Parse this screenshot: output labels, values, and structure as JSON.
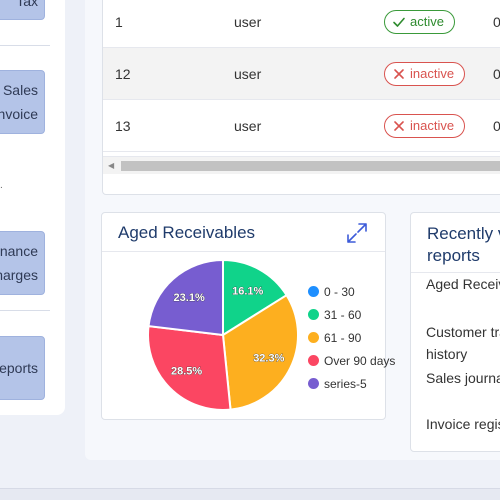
{
  "sidebar": {
    "buttons": [
      {
        "lines": [
          "Tax"
        ]
      },
      {
        "lines": [
          "Sales",
          "Invoice"
        ]
      },
      {
        "lines": [
          "Finance",
          "Charges"
        ]
      },
      {
        "lines": [
          "Reports"
        ]
      }
    ],
    "mark": "."
  },
  "table": {
    "rows": [
      {
        "id": "1",
        "role": "user",
        "status": "active",
        "last": "0"
      },
      {
        "id": "12",
        "role": "user",
        "status": "inactive",
        "last": "0"
      },
      {
        "id": "13",
        "role": "user",
        "status": "inactive",
        "last": "0"
      }
    ]
  },
  "aged_receivables": {
    "title": "Aged Receivables",
    "chart_data": {
      "type": "pie",
      "title": "Aged Receivables",
      "categories": [
        "0 - 30",
        "31 - 60",
        "61 - 90",
        "Over 90 days",
        "series-5"
      ],
      "values": [
        0,
        16.1,
        32.3,
        28.5,
        23.1
      ],
      "labels": [
        "",
        "16.1%",
        "32.3%",
        "28.5%",
        "23.1%"
      ],
      "colors": [
        "#1e8fff",
        "#10d38a",
        "#fdaf1f",
        "#fb4662",
        "#775dd0"
      ],
      "legend": "right"
    }
  },
  "recent_reports": {
    "title_lines": [
      "Recently viewed",
      "reports"
    ],
    "items": [
      {
        "lines": [
          "Aged Receivables"
        ]
      },
      {
        "lines": [
          "Customer transaction",
          "history"
        ]
      },
      {
        "lines": [
          "Sales journal"
        ]
      },
      {
        "lines": [
          "Invoice register"
        ]
      }
    ]
  },
  "colors": {
    "accent": "#1f3b6b",
    "active": "#2e8b2e",
    "inactive": "#d9534f",
    "sidebar_button": "#b4c4e8"
  }
}
